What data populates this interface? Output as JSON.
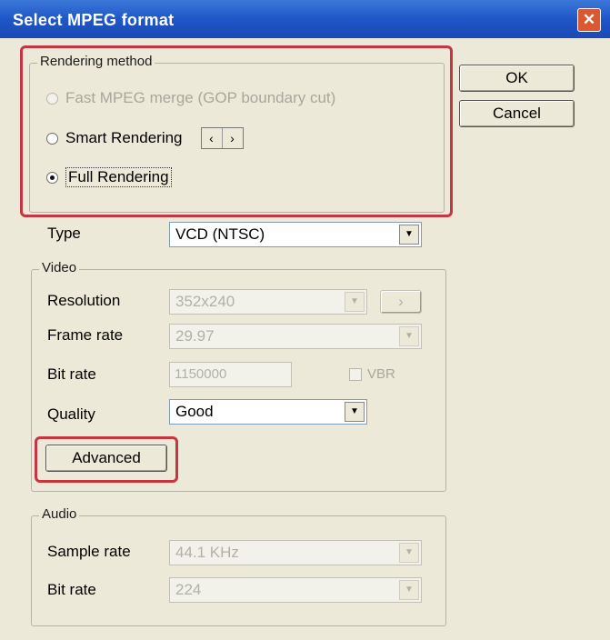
{
  "window": {
    "title": "Select MPEG format",
    "close_glyph": "✕"
  },
  "buttons": {
    "ok": "OK",
    "cancel": "Cancel"
  },
  "rendering": {
    "legend": "Rendering method",
    "options": [
      {
        "label": "Fast MPEG merge (GOP boundary cut)",
        "selected": false,
        "enabled": false
      },
      {
        "label": "Smart Rendering",
        "selected": false,
        "enabled": true
      },
      {
        "label": "Full Rendering",
        "selected": true,
        "enabled": true
      }
    ],
    "spin_left": "‹",
    "spin_right": "›"
  },
  "type": {
    "label": "Type",
    "value": "VCD (NTSC)"
  },
  "video": {
    "legend": "Video",
    "resolution": {
      "label": "Resolution",
      "value": "352x240"
    },
    "frame_rate": {
      "label": "Frame rate",
      "value": "29.97"
    },
    "bit_rate": {
      "label": "Bit rate",
      "value": "1150000"
    },
    "vbr": {
      "label": "VBR"
    },
    "quality": {
      "label": "Quality",
      "value": "Good"
    },
    "advanced_button": "Advanced"
  },
  "audio": {
    "legend": "Audio",
    "sample_rate": {
      "label": "Sample rate",
      "value": "44.1 KHz"
    },
    "bit_rate": {
      "label": "Bit rate",
      "value": "224"
    }
  },
  "colors": {
    "title_bar": "#1f56c8",
    "highlight": "#c8343f",
    "dialog_bg": "#ece9d8"
  }
}
